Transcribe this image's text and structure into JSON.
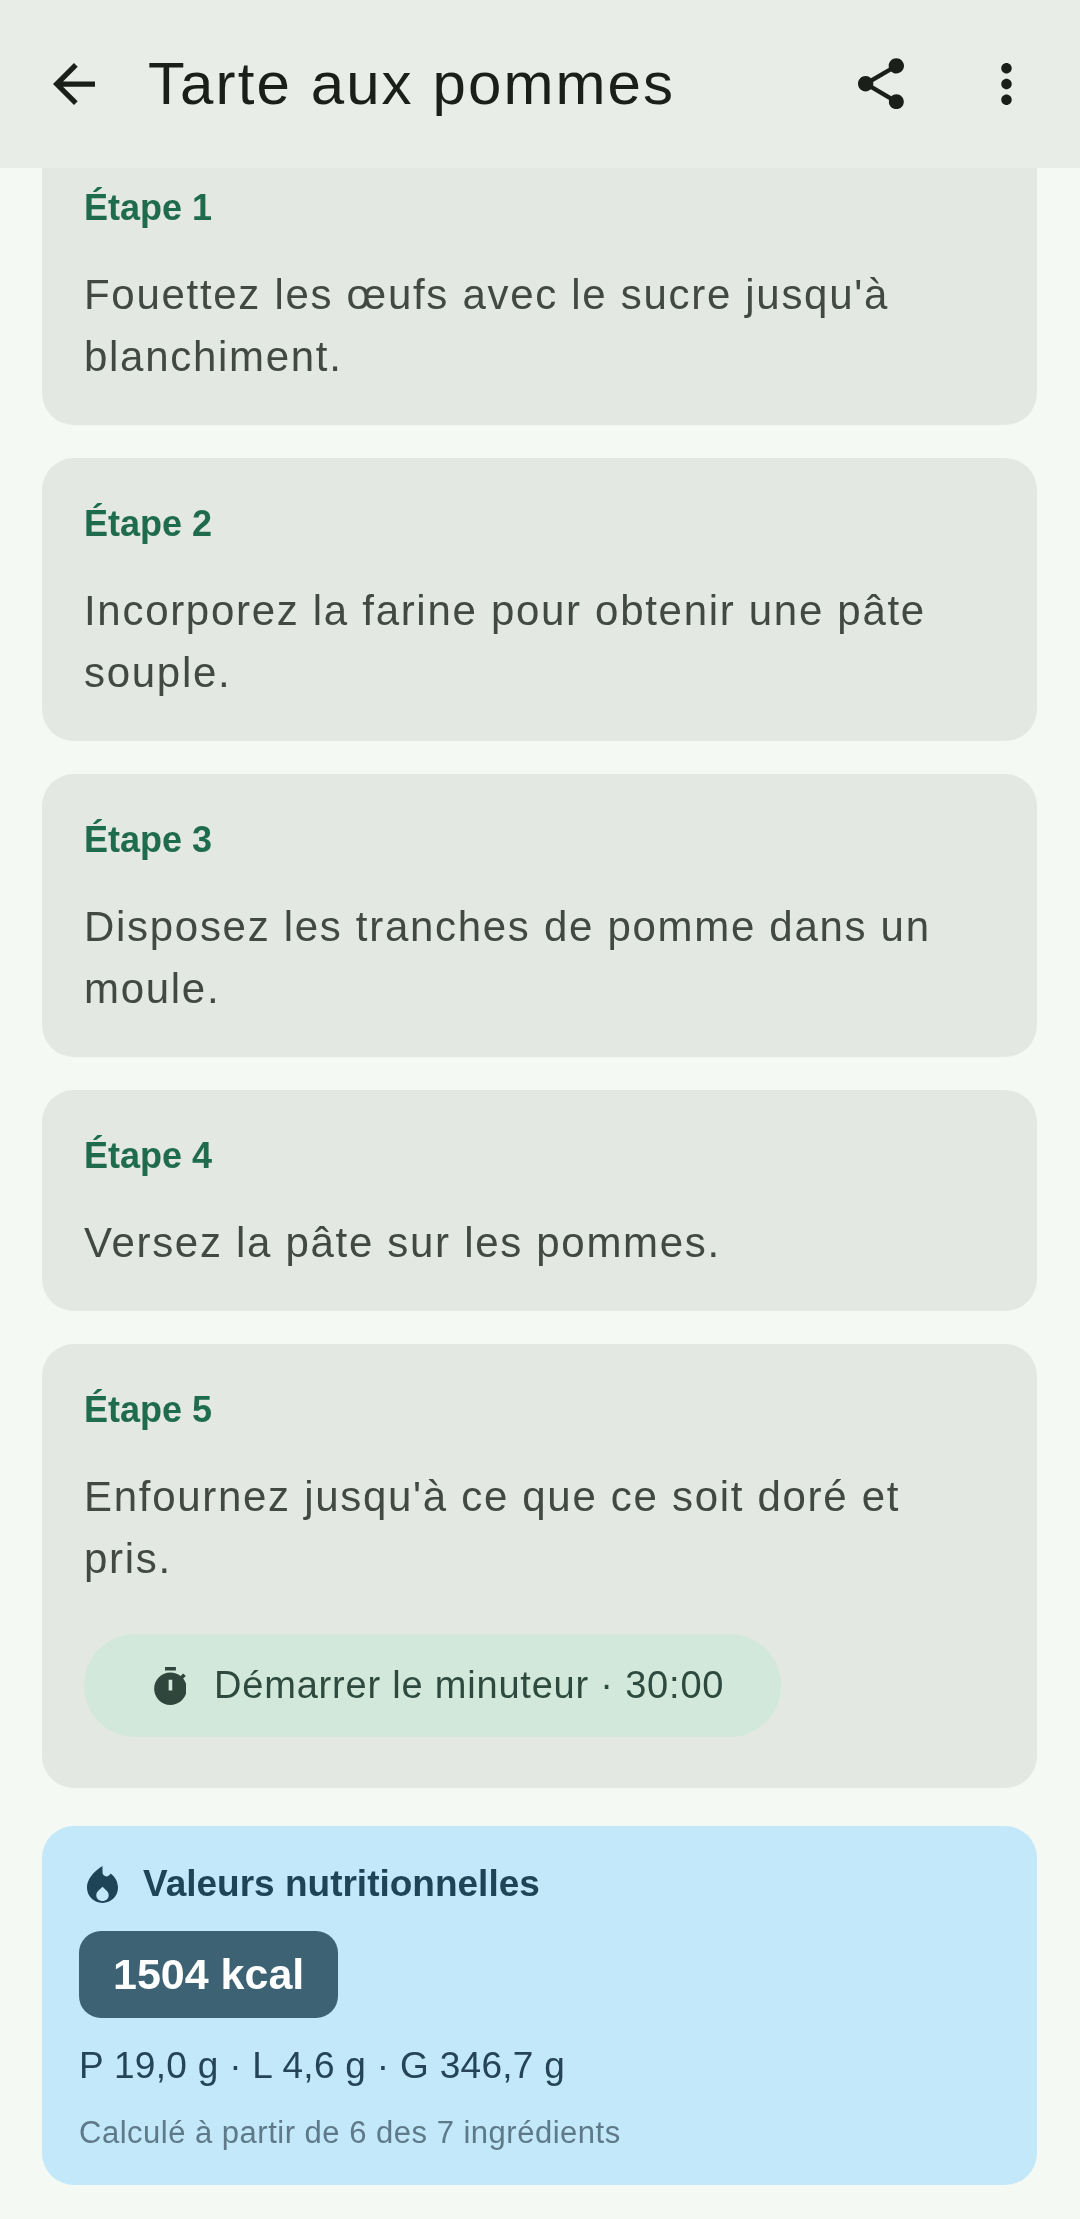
{
  "app_bar": {
    "title": "Tarte aux pommes"
  },
  "steps": [
    {
      "label": "Étape 1",
      "text": "Fouettez les œufs avec le sucre jusqu'à blanchiment."
    },
    {
      "label": "Étape 2",
      "text": "Incorporez la farine pour obtenir une pâte souple."
    },
    {
      "label": "Étape 3",
      "text": "Disposez les tranches de pomme dans un moule."
    },
    {
      "label": "Étape 4",
      "text": "Versez la pâte sur les pommes."
    },
    {
      "label": "Étape 5",
      "text": "Enfournez jusqu'à ce que ce soit doré et pris.",
      "timer": {
        "label": "Démarrer le minuteur · 30:00"
      }
    }
  ],
  "nutrition": {
    "title": "Valeurs nutritionnelles",
    "calories": "1504 kcal",
    "macros": "P 19,0 g · L 4,6 g · G 346,7 g",
    "note": "Calculé à partir de 6 des 7 ingrédients"
  }
}
